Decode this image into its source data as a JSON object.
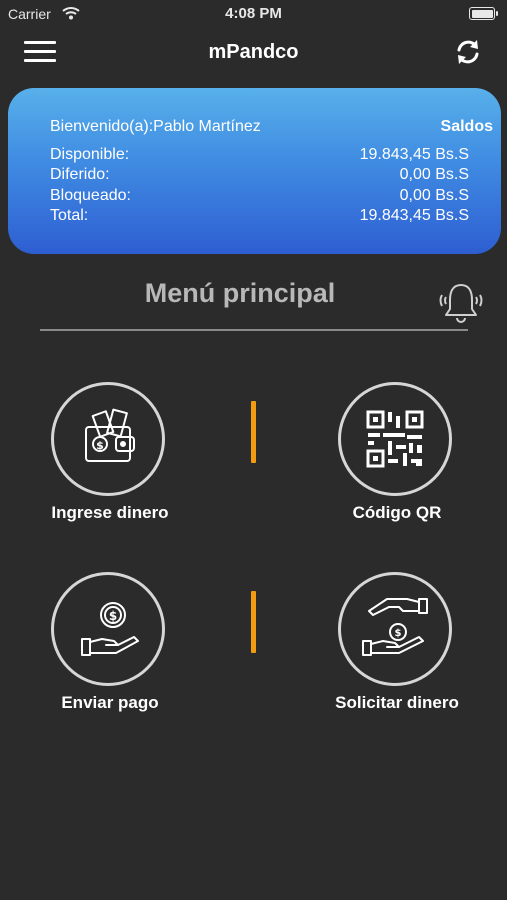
{
  "status_bar": {
    "carrier": "Carrier",
    "time": "4:08 PM"
  },
  "nav": {
    "title": "mPandco",
    "menu_icon": "hamburger-menu-icon",
    "refresh_icon": "refresh-icon"
  },
  "balance": {
    "welcome": "Bienvenido(a):Pablo Martínez",
    "saldos_label": "Saldos",
    "rows": [
      {
        "label": "Disponible:",
        "value": "19.843,45 Bs.S"
      },
      {
        "label": "Diferido:",
        "value": "0,00 Bs.S"
      },
      {
        "label": "Bloqueado:",
        "value": "0,00 Bs.S"
      },
      {
        "label": "Total:",
        "value": "19.843,45 Bs.S"
      }
    ]
  },
  "menu": {
    "title": "Menú principal",
    "bell_icon": "bell-icon",
    "items": [
      {
        "label": "Ingrese dinero",
        "icon": "wallet-money-icon"
      },
      {
        "label": "Código QR",
        "icon": "qr-code-icon"
      },
      {
        "label": "Enviar pago",
        "icon": "hand-coin-icon"
      },
      {
        "label": "Solicitar dinero",
        "icon": "hands-exchange-icon"
      }
    ]
  },
  "colors": {
    "background": "#2b2b2b",
    "card_top": "#58b0ea",
    "card_bottom": "#2e5ed2",
    "accent": "#f39c12"
  }
}
